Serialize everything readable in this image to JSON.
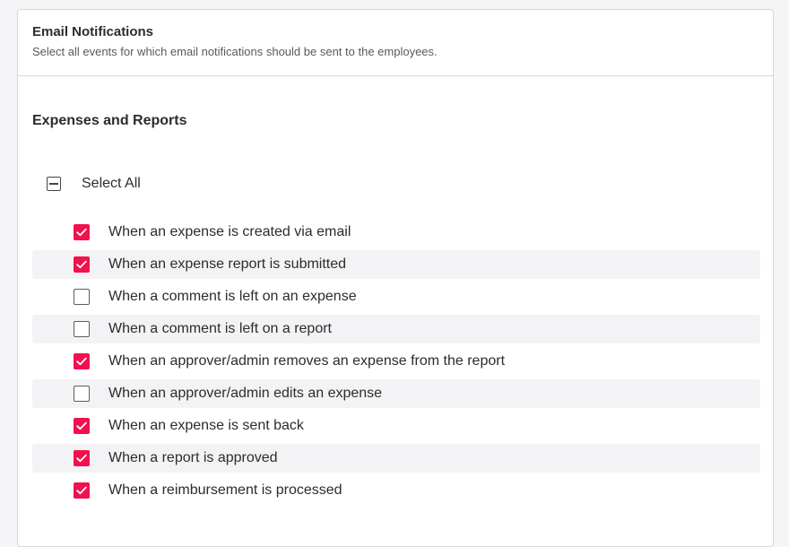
{
  "card": {
    "title": "Email Notifications",
    "subtitle": "Select all events for which email notifications should be sent to the employees."
  },
  "section": {
    "title": "Expenses and Reports"
  },
  "select_all": {
    "label": "Select All",
    "state": "indeterminate"
  },
  "colors": {
    "accent": "#f2114d",
    "row_alt_bg": "#f3f3f6",
    "border": "#d6d6d9"
  },
  "items": [
    {
      "label": "When an expense is created via email",
      "checked": true
    },
    {
      "label": "When an expense report is submitted",
      "checked": true
    },
    {
      "label": "When a comment is left on an expense",
      "checked": false
    },
    {
      "label": "When a comment is left on a report",
      "checked": false
    },
    {
      "label": "When an approver/admin removes an expense from the report",
      "checked": true
    },
    {
      "label": "When an approver/admin edits an expense",
      "checked": false
    },
    {
      "label": "When an expense is sent back",
      "checked": true
    },
    {
      "label": "When a report is approved",
      "checked": true
    },
    {
      "label": "When a reimbursement is processed",
      "checked": true
    }
  ]
}
